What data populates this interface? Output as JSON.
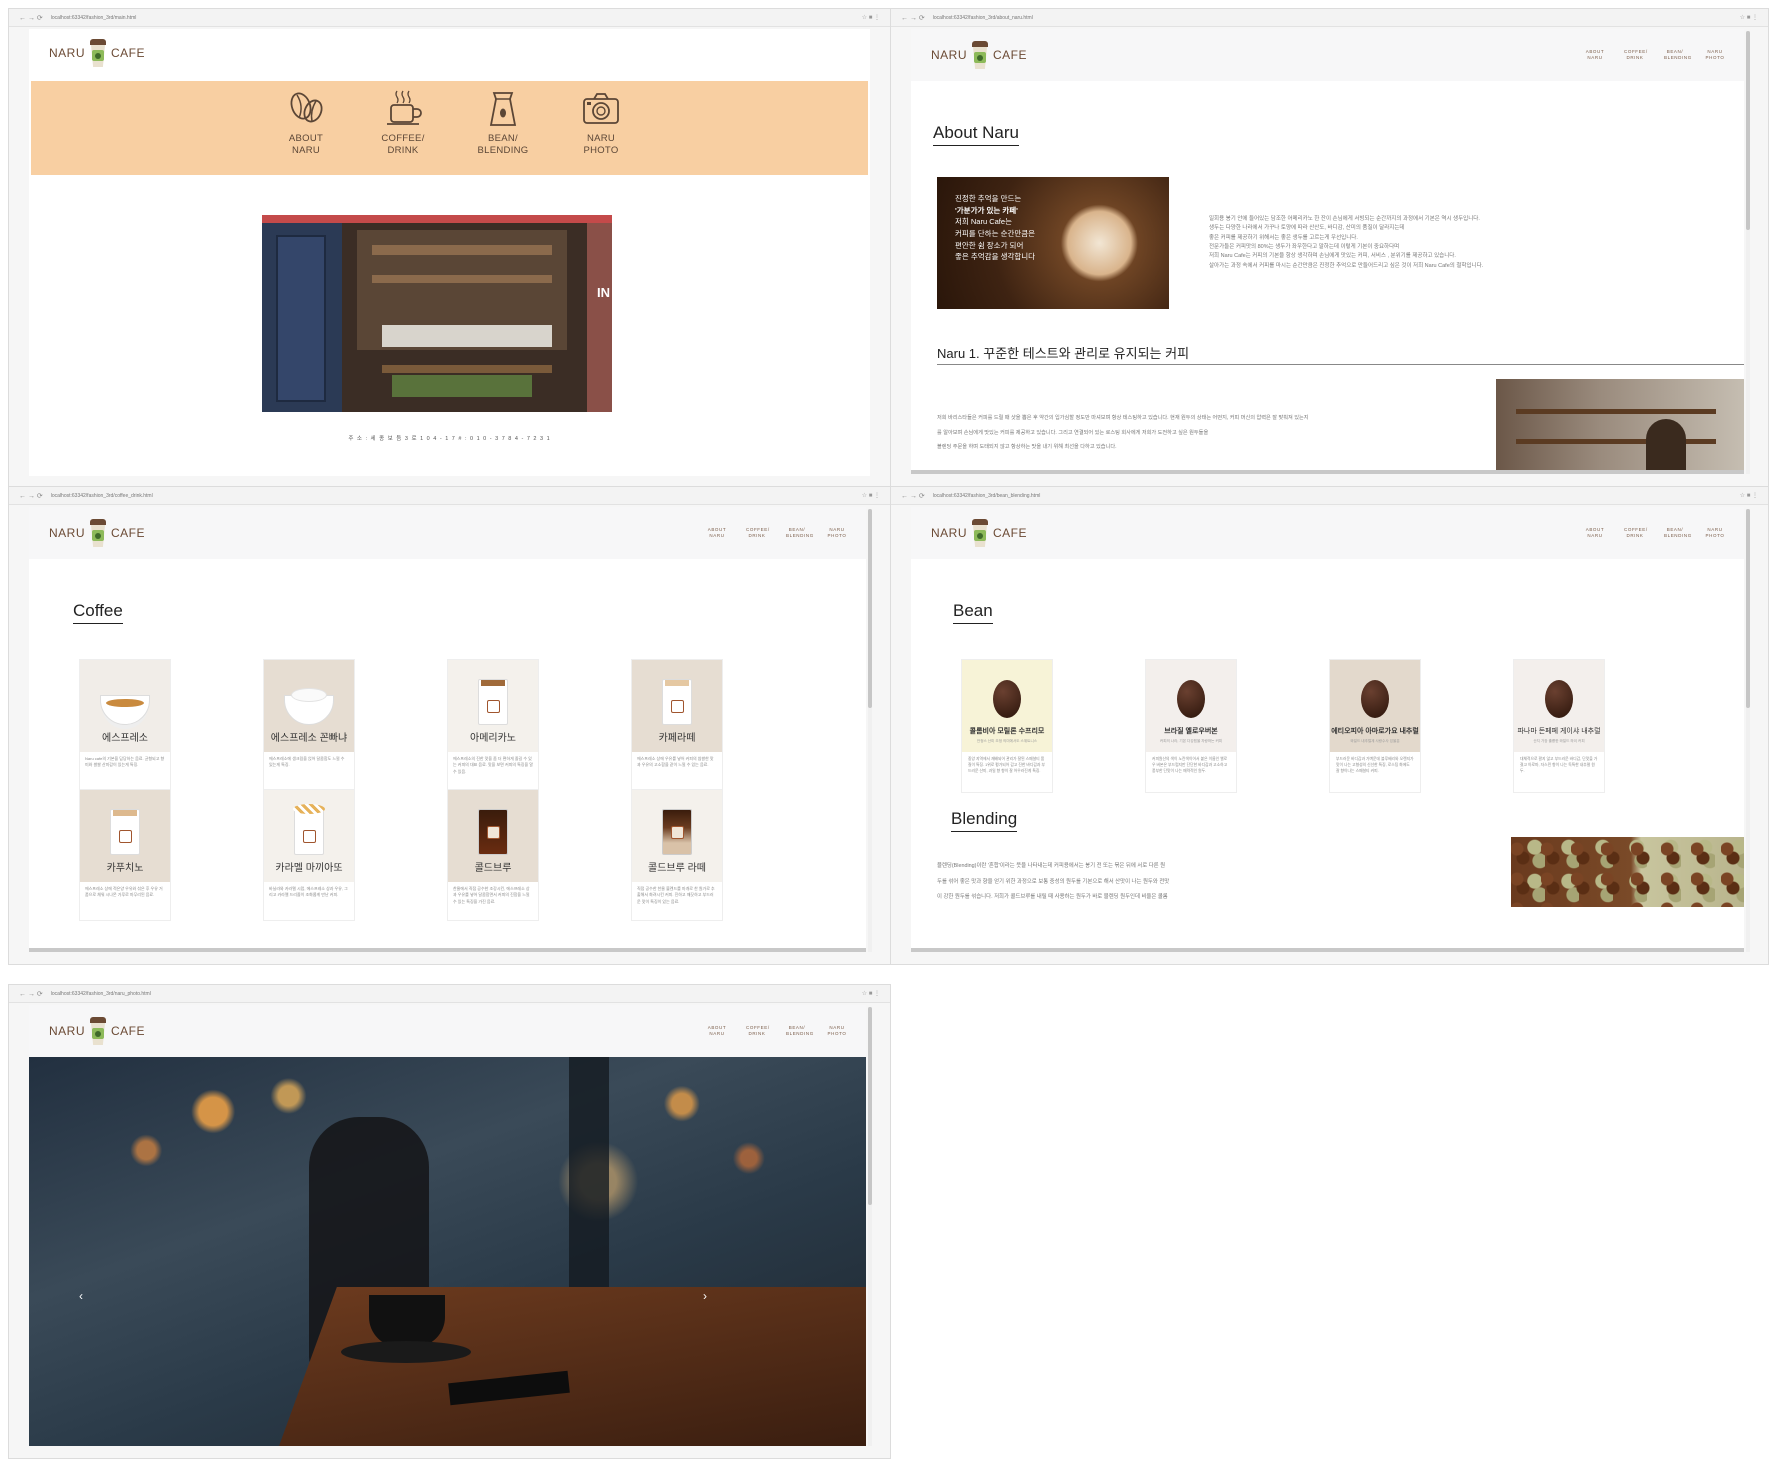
{
  "common": {
    "logo_left": "NARU",
    "logo_right": "CAFE",
    "menu": [
      "ABOUT\nNARU",
      "COFFEE/\nDRINK",
      "BEAN/\nBLENDING",
      "NARU\nPHOTO"
    ]
  },
  "colors": {
    "brown": "#6b4a34",
    "peach": "#f8cfa2",
    "cup_green": "#8dba5a"
  },
  "main_page": {
    "url": "localhost:63342/fashion_3rd/main.html",
    "icons": [
      {
        "label": "ABOUT\nNARU",
        "icon": "coffee-beans-icon"
      },
      {
        "label": "COFFEE/\nDRINK",
        "icon": "coffee-cup-icon"
      },
      {
        "label": "BEAN/\nBLENDING",
        "icon": "bean-bag-icon"
      },
      {
        "label": "NARU\nPHOTO",
        "icon": "camera-icon"
      }
    ],
    "storefront_sign": "IN",
    "address": "주 소 :   세 종   보 듬 3 로   1 0 4 - 1 7   # :   0 1 0 - 3 7 8 4 - 7 2 3 1"
  },
  "about_page": {
    "url": "localhost:63342/fashion_3rd/about_naru.html",
    "title": "About Naru",
    "overlay_lines": [
      "진정한 추억을 만드는",
      "'가분가가 있는 카페'",
      "저희 Naru Cafe는",
      "커피를 단하는 순간만큼은",
      "편안한 쉼 장소가 되어",
      "좋은 추억감을 생각합니다"
    ],
    "intro": [
      "일회용 봉기 안에 들어있는 담조한 어메리카노 한 잔이 손님에게 서빙되는 순간까지의 과정에서 기본은 역시 생두입니다.",
      "생두는 다양한 나라에서 가꾸나 토양에 따라 산산도, 바디감, 산미의 품질이 달라지는데",
      "좋은 커피를 제공하기 위해서는 좋은 생두를 고르는게 우선입니다.",
      "전문가들은 커피맛의 80%는 생두가 좌우한다고 말하는데 이렇게 기본이 중요하다며",
      "저희 Naru Cafe는 커피의 기본을 항상 생각하며 손님에게 맛있는 커피, 서비스 , 분위기를 제공하고 있습니다.",
      "살아가는 과정 속에서 커피를 마시는 순간만큼은 진정한 추억으로 만들어드리고 싶은 것이 저희 Naru Cafe의 철학입니다."
    ],
    "section1_title": "Naru 1. 꾸준한 테스트와 관리로 유지되는 커피",
    "section1_text": [
      "저희 바리스타들은 커피를 드릴 때 샷을 뽑은 후 약간의 입가심할 정도만 마셔보며 항상 테스팅하고 있습니다. 현재 원두의 상태는 어떤지, 커피 머신의 압력은 잘 맞춰져 있는지",
      "를 알아보며 손님에게 맛있는 커피를 제공하고 있습니다. 그리고 연결되어 있는 로스팅 회사에게 저희가 도전하고 싶은 원두들을",
      "블렌딩 주문을 하며 도태되지 않고 항상하는 맛을 내기 위해 최선을 다하고 있습니다."
    ]
  },
  "coffee_page": {
    "url": "localhost:63342/fashion_3rd/coffee_drink.html",
    "title": "Coffee",
    "items": [
      {
        "name": "에스프레소",
        "desc": "Naru cafe의 기본을 담당하는 음료. 균형되고 향미와 쌀쌀 산미감이 있는게 특징."
      },
      {
        "name": "에스프레소 꼰빠냐",
        "desc": "에스프레소에 생크림을 얹어 달콤함도 느낄 수 있는게 특징."
      },
      {
        "name": "아메리카노",
        "desc": "에스프레소의 진한 맛을 좀 더 편하게 즐길 수 있는 커피의 대표 음료. 맛을 보면 커피의 특징을 알 수 있음."
      },
      {
        "name": "카페라떼",
        "desc": "에스프레소 상에 우유를 넣어 커피의 쌉쌀한 맛과 우유의 고소함을 같이 느낄 수 있는 음료."
      },
      {
        "name": "카푸치노",
        "desc": "에스프레소 상에 적은양 우유와 섞은 후 우유 거품으로 채워 시나몬 가루로 마무리된 음료."
      },
      {
        "name": "카라멜 마끼아또",
        "desc": "바닐라와 카라멜 시럽, 에스프레소 상과 우유, 그리고 카라멜 드리즐이 조화롭게 만난 커피."
      },
      {
        "name": "콜드브루",
        "desc": "찬물에서 직접 공수한 조강시킨, 에스프레소 상과 우유를 넣어 달콤함면서 커피의 진함을 느낄 수 있는 특징을 가진 음료."
      },
      {
        "name": "콜드브루 라떼",
        "desc": "직접 공수한 찬물 블렌드를 마개로 찬 원가로 추출해서 화려시킨 커피. 진하고 깨끗하고 부드러운 맛이 특징이 있는 음료."
      }
    ]
  },
  "bean_page": {
    "url": "localhost:63342/fashion_3rd/bean_blending.html",
    "title": "Bean",
    "beans": [
      {
        "name": "콜롬비아 모릴론 수프리모",
        "sub": "안정스 산미 조정 의미에서도 스위트니스",
        "desc": "중앙 지역에서 재배되어 관리가 잘된 스페셜티 품질이 특징. 1위로 평가되어 감고 진한 바디감과 부드러운 산미, 과일 향 향이 잘 어우러진게 특징."
      },
      {
        "name": "브라질 옐로우버본",
        "sub": "커피의 나라, 기본 다강힘을 자랑하는 커피",
        "desc": "커피원산의 색이 노란색이어서 붙은 이름인 옐로우 버본은 부드럽지만 단단한 바디감과 고소하고 풍부한 단맛이 나는 매력적인 원두."
      },
      {
        "name": "에티오피아 아마로가요 내추럴",
        "sub": "와일드 내추럴계 사랑수사 있을분",
        "desc": "부드러운 바디감과 가벼운데 블루베리와 오렌지가 맛이 나는 고형성의 신선한 특징, 로스팅 화에도 잘 향이나는 스페셜티 커피."
      },
      {
        "name": "파나마 돈페페 게이샤 내추럴",
        "sub": "산지 가장 훌륭한 와일드 하이 커피",
        "desc": "대체적으로 팔지 않고 부드러운 바디감, 단맛을 가졌고 아로마, 자스민 향이 나는 독특한 내추럴 원두."
      }
    ],
    "blending_title": "Blending",
    "blending_text": [
      "블렌딩(Blending)이란 '혼합'이라는 뜻을 나타내는데 커피용에서는 봉기 전 또는 볶은 뒤에 서로 다른 원",
      "두를 섞어 좋은 맛과 향을 얻기 위한 과정으로 보통 중성의 원두를 기본으로 해서 산맛이 나는 원두와 전맛",
      "이 강한 원두를 섞습니다. 저희가 콜드브루를 내릴 때 사용하는 원두가 바로 블렌딩 원두인데 비율은 콜롬"
    ]
  },
  "photo_page": {
    "url": "localhost:63342/fashion_3rd/naru_photo.html",
    "prev_arrow": "‹",
    "next_arrow": "›"
  }
}
